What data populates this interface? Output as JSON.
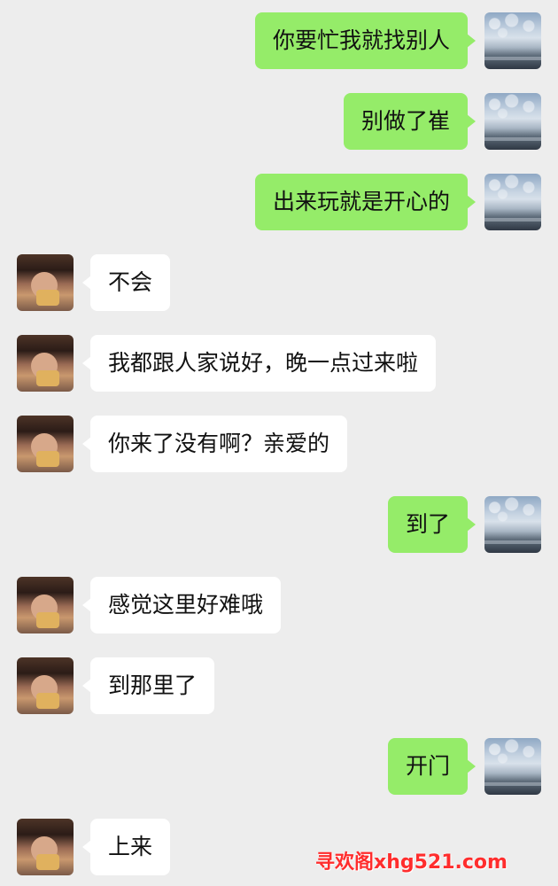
{
  "messages": [
    {
      "sender": "me",
      "text": "你要忙我就找别人"
    },
    {
      "sender": "me",
      "text": "别做了崔"
    },
    {
      "sender": "me",
      "text": "出来玩就是开心的"
    },
    {
      "sender": "friend",
      "text": "不会"
    },
    {
      "sender": "friend",
      "text": "我都跟人家说好，晚一点过来啦"
    },
    {
      "sender": "friend",
      "text": "你来了没有啊？亲爱的"
    },
    {
      "sender": "me",
      "text": "到了"
    },
    {
      "sender": "friend",
      "text": "感觉这里好难哦"
    },
    {
      "sender": "friend",
      "text": "到那里了"
    },
    {
      "sender": "me",
      "text": "开门"
    },
    {
      "sender": "friend",
      "text": "上来"
    }
  ],
  "watermark": "寻欢阁xhg521.com",
  "colors": {
    "background": "#ededed",
    "my_bubble": "#95ec69",
    "friend_bubble": "#ffffff",
    "watermark": "#ff2d2d"
  }
}
